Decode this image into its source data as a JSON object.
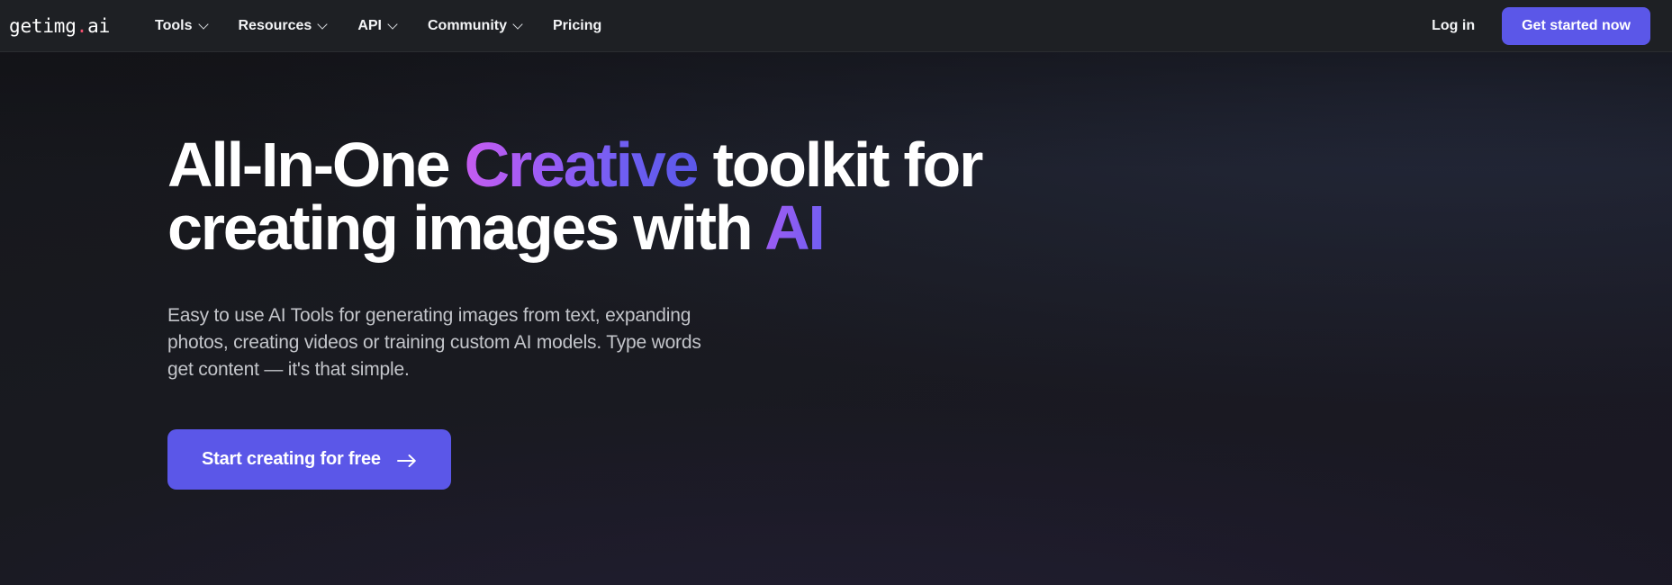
{
  "brand": {
    "text_before": "getimg",
    "dot": ".",
    "text_after": "ai"
  },
  "nav": {
    "items": [
      {
        "label": "Tools",
        "has_chevron": true,
        "icon": "chevron-down-icon"
      },
      {
        "label": "Resources",
        "has_chevron": true,
        "icon": "chevron-down-icon"
      },
      {
        "label": "API",
        "has_chevron": true,
        "icon": "chevron-down-icon"
      },
      {
        "label": "Community",
        "has_chevron": true,
        "icon": "chevron-down-icon"
      },
      {
        "label": "Pricing",
        "has_chevron": false,
        "icon": null
      }
    ],
    "login_label": "Log in",
    "cta_label": "Get started now"
  },
  "hero": {
    "headline": {
      "line1_part1": "All-In-One ",
      "line1_accent": "Creative",
      "line1_part2": " toolkit for",
      "line2_part1": "creating images with ",
      "line2_accent": "AI"
    },
    "subheadline": "Easy to use AI Tools for generating images from text, expanding photos, creating videos or training custom AI models. Type words get content — it's that simple.",
    "cta_label": "Start creating for free",
    "cta_icon": "arrow-right-icon"
  },
  "colors": {
    "accent_purple": "#5b57e8",
    "brand_dot_pink": "#f0506e",
    "navbar_bg": "#1e2024",
    "hero_bg": "#191a20",
    "gradient_start": "#c65cf0",
    "gradient_end": "#5b57e8",
    "text_primary": "#ffffff",
    "text_secondary": "#c3c5ca"
  }
}
